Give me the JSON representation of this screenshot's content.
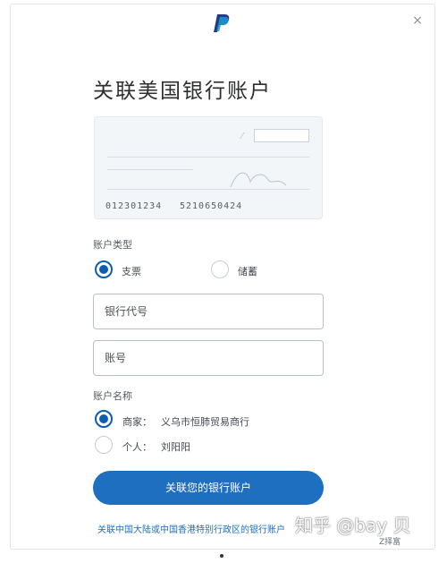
{
  "header": {
    "title": "关联美国银行账户",
    "close_glyph": "×",
    "logo_icon": "paypal-logo-icon"
  },
  "check_image": {
    "routing_number": "012301234",
    "account_number": "5210650424"
  },
  "account_type": {
    "label": "账户类型",
    "options": [
      {
        "label": "支票",
        "selected": true
      },
      {
        "label": "储蓄",
        "selected": false
      }
    ]
  },
  "fields": {
    "routing": {
      "placeholder": "银行代号",
      "value": ""
    },
    "account": {
      "placeholder": "账号",
      "value": ""
    }
  },
  "account_name": {
    "label": "账户名称",
    "options": [
      {
        "label": "商家：",
        "value": "义乌市恒肺贸易商行",
        "selected": true
      },
      {
        "label": "个人：",
        "value": "刘阳阳",
        "selected": false
      }
    ]
  },
  "submit": {
    "label": "关联您的银行账户"
  },
  "footer": {
    "link": "关联中国大陆或中国香港特别行政区的银行账户",
    "corner_text": "Z择富"
  },
  "watermark": {
    "text": "知乎 @bay 贝"
  },
  "colors": {
    "accent": "#1f6fc0",
    "radio_selected": "#0e5db0"
  }
}
